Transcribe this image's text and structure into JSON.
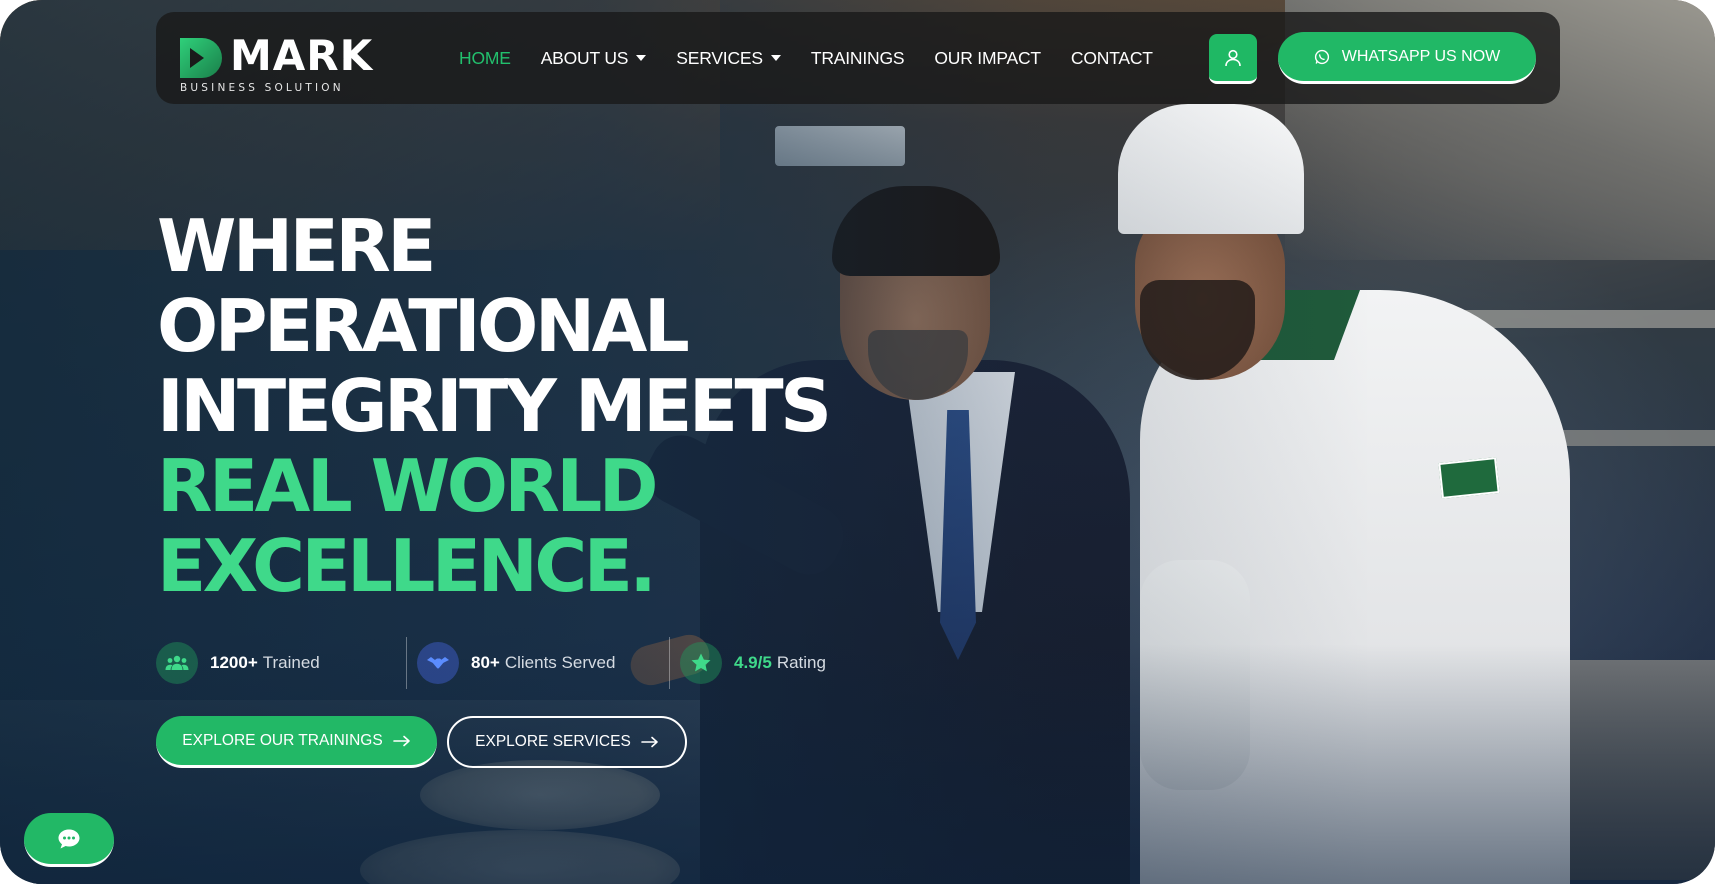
{
  "brand": {
    "name": "MARK",
    "tagline": "BUSINESS SOLUTION",
    "accent": "#22b866",
    "accent_light": "#3fd98a"
  },
  "nav": {
    "items": [
      {
        "label": "HOME",
        "active": true,
        "dropdown": false
      },
      {
        "label": "ABOUT US",
        "active": false,
        "dropdown": true
      },
      {
        "label": "SERVICES",
        "active": false,
        "dropdown": true
      },
      {
        "label": "TRAININGS",
        "active": false,
        "dropdown": false
      },
      {
        "label": "OUR IMPACT",
        "active": false,
        "dropdown": false
      },
      {
        "label": "CONTACT",
        "active": false,
        "dropdown": false
      }
    ],
    "account_icon": "user-icon",
    "whatsapp_label": "WHATSAPP US NOW",
    "whatsapp_icon": "whatsapp-icon"
  },
  "hero": {
    "lines_white": [
      "WHERE",
      "OPERATIONAL",
      "INTEGRITY MEETS"
    ],
    "lines_green": [
      "REAL WORLD",
      "EXCELLENCE."
    ]
  },
  "stats": [
    {
      "icon": "users-icon",
      "number": "1200+",
      "label": "Trained"
    },
    {
      "icon": "handshake-icon",
      "number": "80+",
      "label": "Clients Served"
    },
    {
      "icon": "star-icon",
      "number": "4.9/5",
      "label": "Rating"
    }
  ],
  "cta": {
    "primary_label": "EXPLORE OUR TRAININGS",
    "secondary_label": "EXPLORE SERVICES",
    "arrow_icon": "arrow-right-icon"
  },
  "chat": {
    "icon": "chat-bubble-icon"
  }
}
